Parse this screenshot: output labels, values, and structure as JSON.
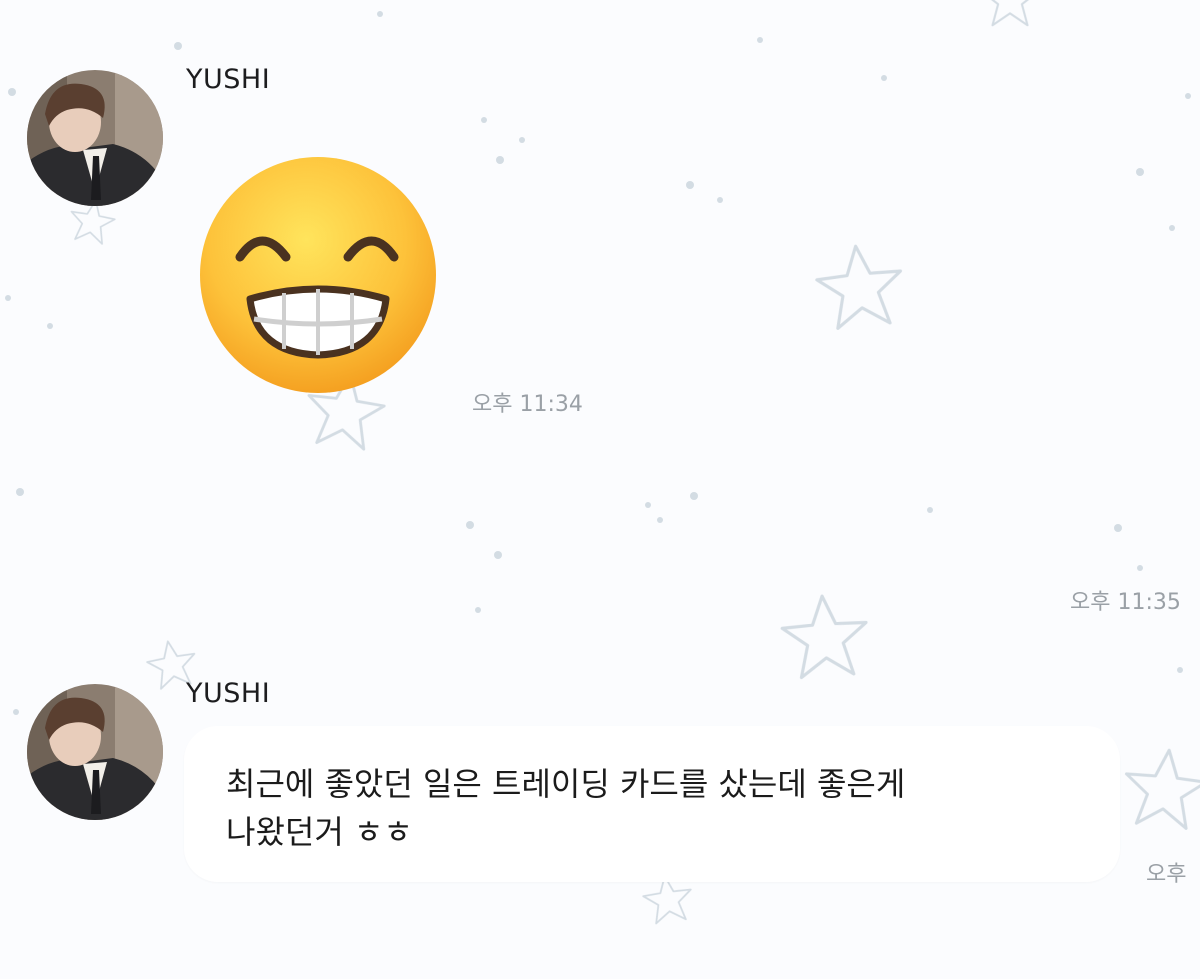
{
  "chat": {
    "messages": [
      {
        "sender": "YUSHI",
        "type": "emoticon",
        "emoticon": "grinning-face-with-smiling-eyes",
        "time": "오후 11:34"
      },
      {
        "type": "read-time",
        "time": "오후 11:35"
      },
      {
        "sender": "YUSHI",
        "type": "text",
        "text": "최근에 좋았던 일은 트레이딩 카드를 샀는데 좋은게\n나왔던거 ㅎㅎ",
        "time": "오후"
      }
    ]
  },
  "colors": {
    "background": "#fbfcfe",
    "bubble": "#ffffff",
    "time_text": "#9aa0a6",
    "star": "#c9d3dc"
  }
}
